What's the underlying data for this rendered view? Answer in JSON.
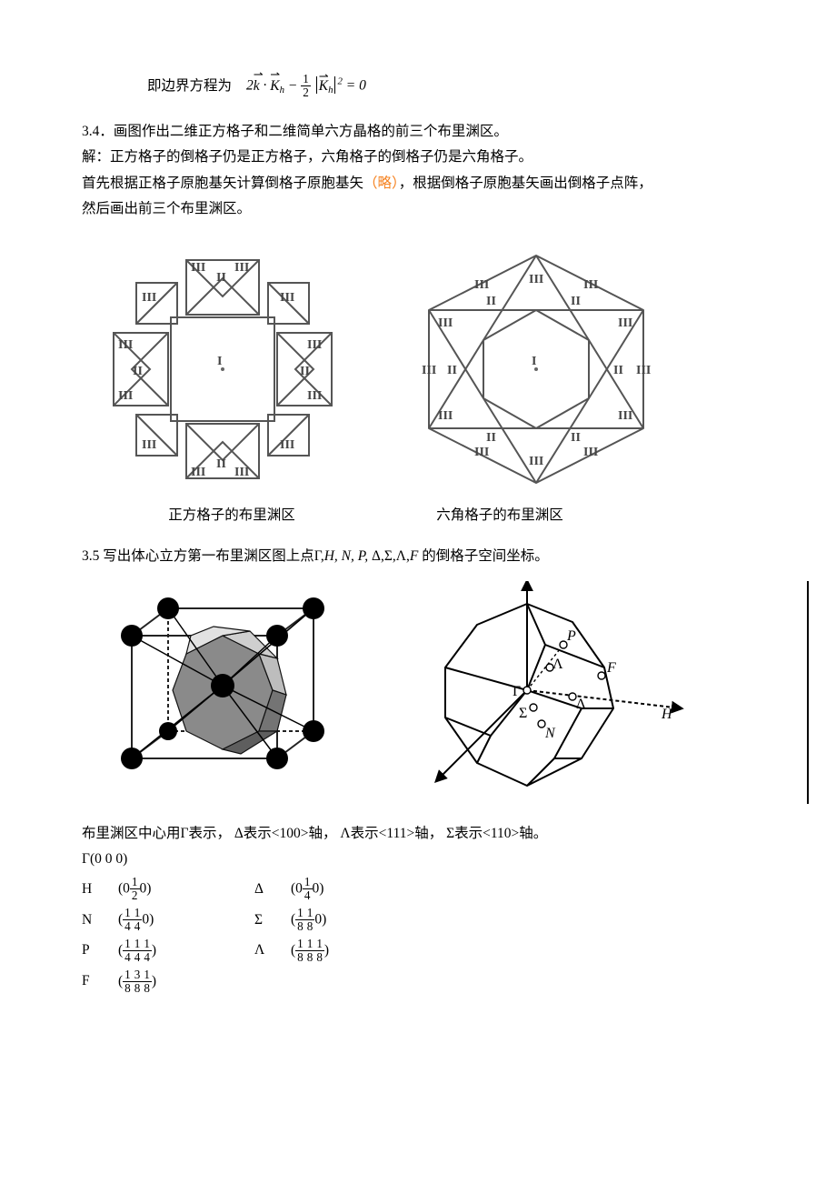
{
  "equation": {
    "prefix": "即边界方程为"
  },
  "q34": {
    "number": "3.4．",
    "title": "画图作出二维正方格子和二维简单六方晶格的前三个布里渊区。",
    "sol_label": "解：",
    "line1": "正方格子的倒格子仍是正方格子，六角格子的倒格子仍是六角格子。",
    "line2a": "首先根据正格子原胞基矢计算倒格子原胞基矢",
    "omit": "（略）",
    "line2b": "，根据倒格子原胞基矢画出倒格子点阵，",
    "line3": "然后画出前三个布里渊区。",
    "caption_square": "正方格子的布里渊区",
    "caption_hex": "六角格子的布里渊区"
  },
  "q35": {
    "number_and_title": "3.5 写出体心立方第一布里渊区图上点Γ,",
    "symbols_italic": "H, N, P,",
    "symbols_greek": " Δ,Σ,Λ,",
    "f_italic": "F",
    "tail": " 的倒格子空间坐标。",
    "expl": "布里渊区中心用Γ表示， Δ表示<100>轴， Λ表示<111>轴， Σ表示<110>轴。",
    "gamma": "Γ(0 0 0)",
    "rows": [
      {
        "l": "H",
        "v": [
          "0",
          "1",
          "2",
          "0"
        ],
        "l2": "Δ",
        "v2": [
          "0",
          "1",
          "4",
          "0"
        ]
      },
      {
        "l": "N",
        "v": [
          "1",
          "4",
          "1",
          "4",
          "0"
        ],
        "l2": "Σ",
        "v2": [
          "1",
          "8",
          "1",
          "8",
          "0"
        ]
      },
      {
        "l": "P",
        "v": [
          "1",
          "4",
          "1",
          "4",
          "1",
          "4"
        ],
        "l2": "Λ",
        "v2": [
          "1",
          "8",
          "1",
          "8",
          "1",
          "8"
        ]
      },
      {
        "l": "F",
        "v": [
          "1",
          "8",
          "3",
          "8",
          "1",
          "8"
        ]
      }
    ]
  },
  "labels": {
    "I": "I",
    "II": "II",
    "III": "III"
  },
  "fig35": {
    "P": "P",
    "F": "F",
    "G": "Γ",
    "L": "Λ",
    "D": "Δ",
    "S": "Σ",
    "N": "N",
    "H": "H"
  }
}
